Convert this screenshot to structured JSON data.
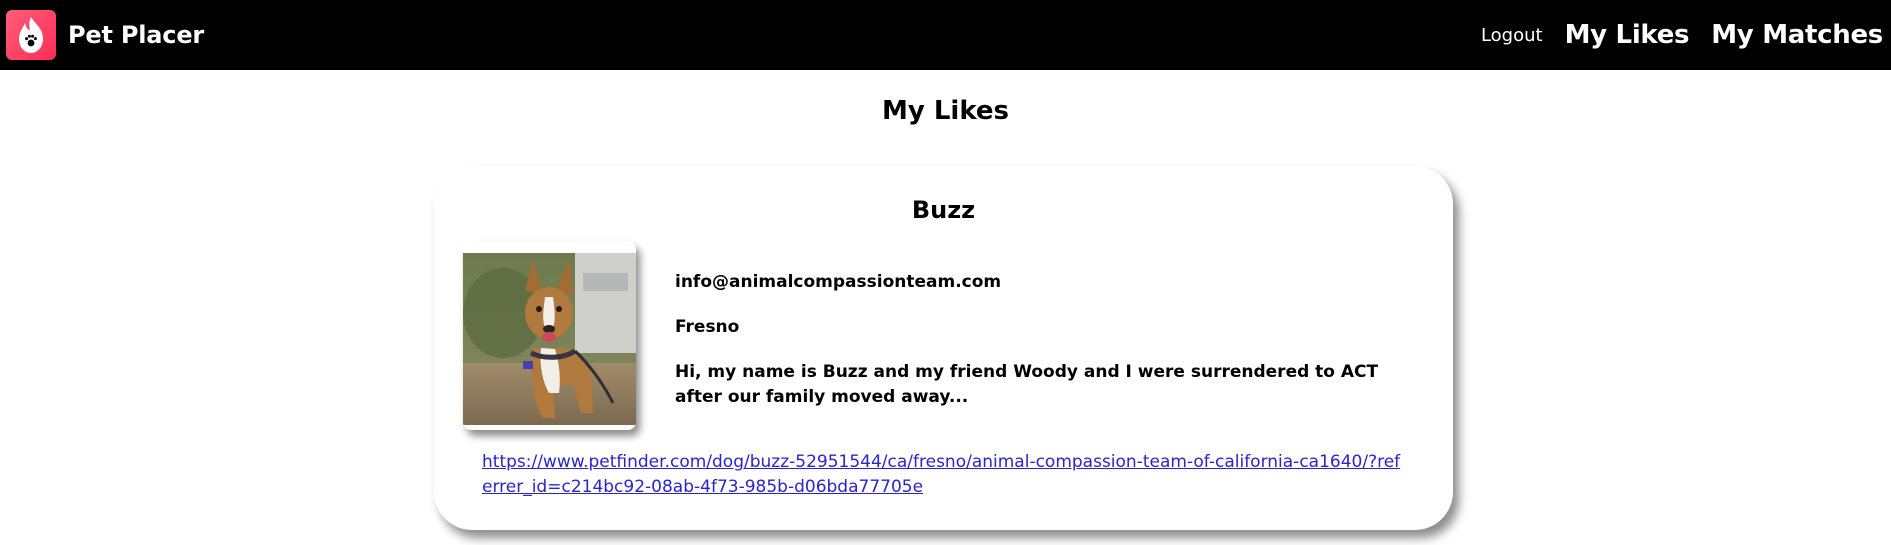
{
  "nav": {
    "brand": "Pet Placer",
    "logout_label": "Logout",
    "my_likes_label": "My Likes",
    "my_matches_label": "My Matches"
  },
  "page": {
    "title": "My Likes"
  },
  "likes": [
    {
      "name": "Buzz",
      "email": "info@animalcompassionteam.com",
      "city": "Fresno",
      "description": "Hi, my name is Buzz and my friend Woody and I were surrendered to ACT after our family moved away...",
      "link": "https://www.petfinder.com/dog/buzz-52951544/ca/fresno/animal-compassion-team-of-california-ca1640/?referrer_id=c214bc92-08ab-4f73-985b-d06bda77705e"
    }
  ],
  "colors": {
    "navbar_bg": "#000000",
    "logo_accent": "#fd2d55",
    "link": "#2b24c9"
  },
  "icons": {
    "logo": "flame-paw-icon"
  }
}
